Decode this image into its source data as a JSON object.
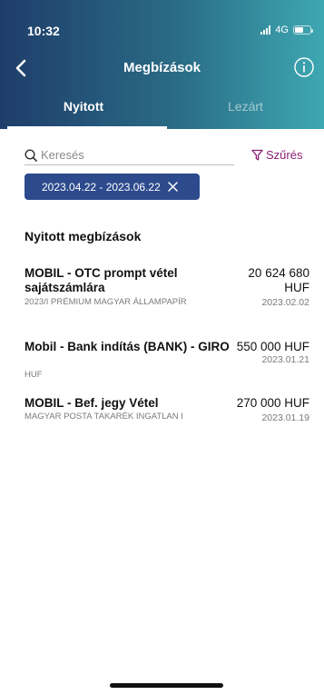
{
  "status": {
    "time": "10:32",
    "network": "4G"
  },
  "header": {
    "title": "Megbízások"
  },
  "tabs": [
    {
      "label": "Nyitott",
      "active": true
    },
    {
      "label": "Lezárt",
      "active": false
    }
  ],
  "search": {
    "placeholder": "Keresés",
    "value": ""
  },
  "filter": {
    "label": "Szűrés"
  },
  "date_chip": {
    "label": "2023.04.22 - 2023.06.22"
  },
  "section": {
    "title": "Nyitott megbízások"
  },
  "orders": [
    {
      "name": "MOBIL - OTC prompt vétel sajátszámlára",
      "sub": "2023/I PRÉMIUM MAGYAR ÁLLAMPAPÍR",
      "amount": "20 624 680",
      "currency": "HUF",
      "date": "2023.02.02"
    },
    {
      "name": "Mobil - Bank indítás (BANK) - GIRO",
      "sub": "HUF",
      "amount": "550 000 HUF",
      "currency": "",
      "date": "2023.01.21"
    },
    {
      "name": "MOBIL - Bef. jegy Vétel",
      "sub": "MAGYAR POSTA TAKARÉK INGATLAN I",
      "amount": "270 000 HUF",
      "currency": "",
      "date": "2023.01.19"
    }
  ],
  "colors": {
    "accent": "#8b1e74",
    "chip": "#2c4a8c",
    "header_start": "#1f3d6a",
    "header_end": "#3ea8b2"
  }
}
